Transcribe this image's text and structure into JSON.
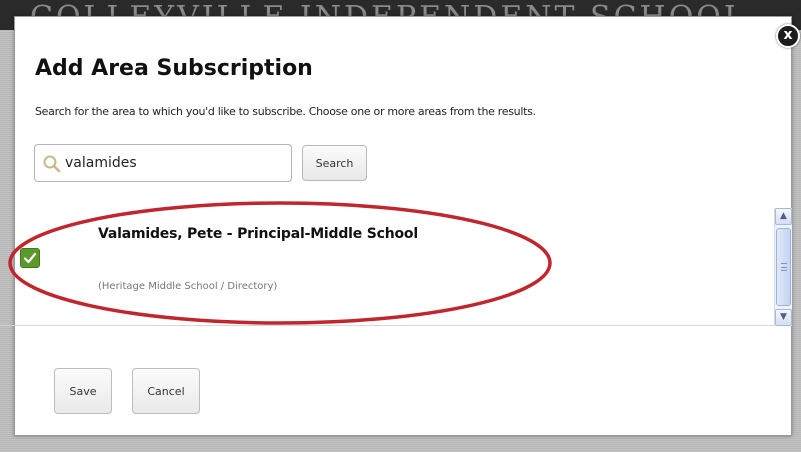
{
  "background": {
    "banner_text": "COLLEYVILLE INDEPENDENT SCHOOL"
  },
  "dialog": {
    "close_label": "x",
    "title": "Add Area Subscription",
    "instructions": "Search for the area to which you'd like to subscribe. Choose one or more areas from the results.",
    "search": {
      "value": "valamides",
      "placeholder": "",
      "button_label": "Search",
      "icon": "search-icon"
    },
    "results": [
      {
        "checked": true,
        "name": "Valamides, Pete - Principal-Middle School",
        "path": "(Heritage Middle School / Directory)"
      }
    ],
    "footer": {
      "save_label": "Save",
      "cancel_label": "Cancel"
    }
  },
  "colors": {
    "checkbox": "#5a9a2c",
    "highlight_circle": "#c0262d",
    "close_button": "#1c1c1c"
  }
}
